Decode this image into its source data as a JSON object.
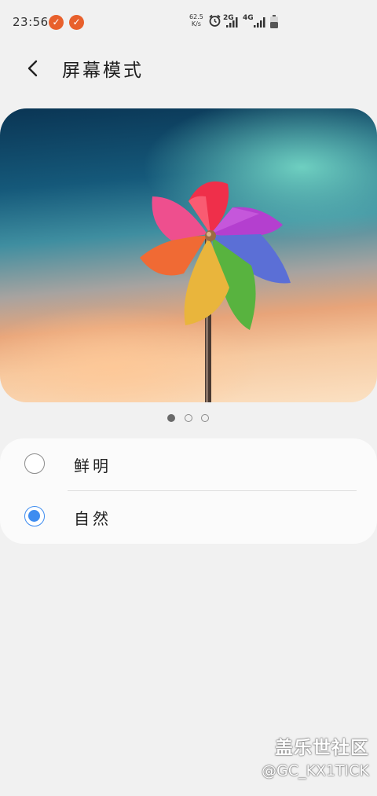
{
  "status_bar": {
    "time": "23:56",
    "net_speed_value": "62.5",
    "net_speed_unit": "K/s",
    "sim1_label": "2G",
    "sim2_label": "4G"
  },
  "header": {
    "title": "屏幕模式"
  },
  "pager": {
    "total": 3,
    "active_index": 0
  },
  "options": [
    {
      "label": "鲜明",
      "selected": false
    },
    {
      "label": "自然",
      "selected": true
    }
  ],
  "watermark": {
    "brand": "盖乐世社区",
    "user": "@GC_KX1TICK"
  },
  "colors": {
    "accent": "#3e8cf0",
    "notification": "#e8602c",
    "background": "#f1f1f1"
  }
}
